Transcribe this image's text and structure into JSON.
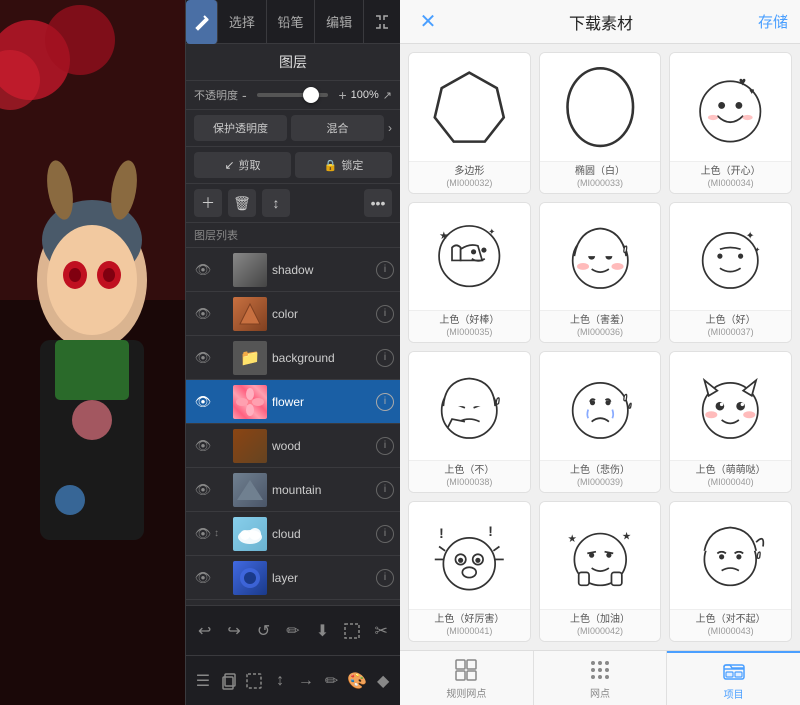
{
  "leftPanel": {
    "toolbar": {
      "select_label": "选择",
      "pencil_label": "铅笔",
      "edit_label": "编辑"
    },
    "layers": {
      "title": "图层",
      "opacity_label": "不透明度",
      "opacity_value": "100%",
      "opacity_minus": "-",
      "opacity_plus": "+",
      "protect_label": "保护透明度",
      "blend_label": "混合",
      "clip_label": "剪取",
      "lock_label": "锁定",
      "list_label": "图层列表",
      "items": [
        {
          "name": "shadow",
          "visible": true,
          "active": false,
          "thumb": "shadow"
        },
        {
          "name": "color",
          "visible": true,
          "active": false,
          "thumb": "color"
        },
        {
          "name": "background",
          "visible": true,
          "active": false,
          "thumb": "bg"
        },
        {
          "name": "flower",
          "visible": true,
          "active": true,
          "thumb": "flower"
        },
        {
          "name": "wood",
          "visible": true,
          "active": false,
          "thumb": "wood"
        },
        {
          "name": "mountain",
          "visible": true,
          "active": false,
          "thumb": "mountain"
        },
        {
          "name": "cloud",
          "visible": true,
          "active": false,
          "thumb": "cloud",
          "extra": "↕"
        },
        {
          "name": "layer",
          "visible": true,
          "active": false,
          "thumb": "layer"
        }
      ]
    },
    "bottomTools": [
      "↩",
      "↪",
      "↺",
      "✏",
      "⬇",
      "⬜",
      "✂"
    ],
    "bottomTools2": [
      "☰",
      "⬜",
      "⬜",
      "↕",
      "→",
      "✏",
      "🎨",
      "◆"
    ]
  },
  "rightPanel": {
    "title": "下载素材",
    "save_label": "存储",
    "close_label": "✕",
    "materials": [
      {
        "name": "多边形",
        "id": "(MI000032)",
        "shape": "polygon"
      },
      {
        "name": "椭圆（白）",
        "id": "(MI000033)",
        "shape": "oval"
      },
      {
        "name": "上色（开心）",
        "id": "(MI000034)",
        "shape": "happy"
      },
      {
        "name": "上色（好棒）",
        "id": "(MI000035)",
        "shape": "goodjob"
      },
      {
        "name": "上色（害羞）",
        "id": "(MI000036)",
        "shape": "shy"
      },
      {
        "name": "上色（好）",
        "id": "(MI000037)",
        "shape": "good"
      },
      {
        "name": "上色（不）",
        "id": "(MI000038)",
        "shape": "no"
      },
      {
        "name": "上色（悲伤）",
        "id": "(MI000039)",
        "shape": "sad"
      },
      {
        "name": "上色（萌萌哒）",
        "id": "(MI000040)",
        "shape": "cute"
      },
      {
        "name": "上色（好厉害）",
        "id": "(MI000041)",
        "shape": "amazing"
      },
      {
        "name": "上色（加油）",
        "id": "(MI000042)",
        "shape": "cheer"
      },
      {
        "name": "上色（对不起）",
        "id": "(MI000043)",
        "shape": "sorry"
      }
    ],
    "bottomNav": [
      {
        "label": "规则网点",
        "icon": "grid1",
        "active": false
      },
      {
        "label": "网点",
        "icon": "grid2",
        "active": false
      },
      {
        "label": "项目",
        "icon": "folder",
        "active": true
      }
    ]
  }
}
